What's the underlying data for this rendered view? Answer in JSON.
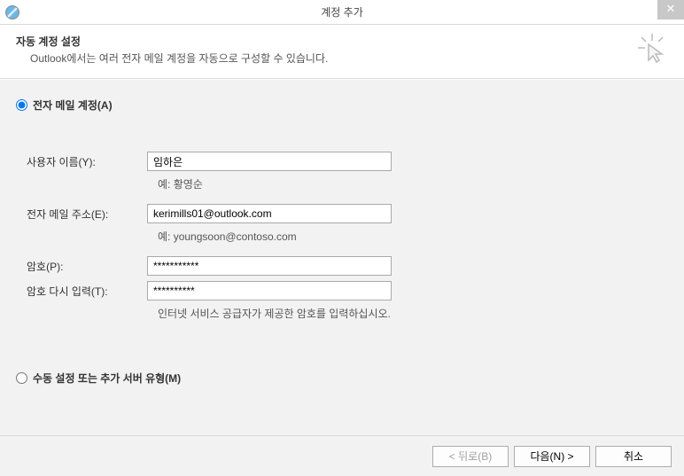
{
  "window": {
    "title": "계정 추가"
  },
  "header": {
    "title": "자동 계정 설정",
    "description": "Outlook에서는 여러 전자 메일 계정을 자동으로 구성할 수 있습니다."
  },
  "options": {
    "email_account_label": "전자 메일 계정(A)",
    "manual_label": "수동 설정 또는 추가 서버 유형(M)"
  },
  "form": {
    "name_label": "사용자 이름(Y):",
    "name_value": "임하은",
    "name_hint": "예: 황영순",
    "email_label": "전자 메일 주소(E):",
    "email_value": "kerimills01@outlook.com",
    "email_hint": "예: youngsoon@contoso.com",
    "password_label": "암호(P):",
    "password_value": "***********",
    "password_confirm_label": "암호 다시 입력(T):",
    "password_confirm_value": "**********",
    "password_hint": "인터넷 서비스 공급자가 제공한 암호를 입력하십시오."
  },
  "footer": {
    "back": "< 뒤로(B)",
    "next": "다음(N) >",
    "cancel": "취소"
  }
}
